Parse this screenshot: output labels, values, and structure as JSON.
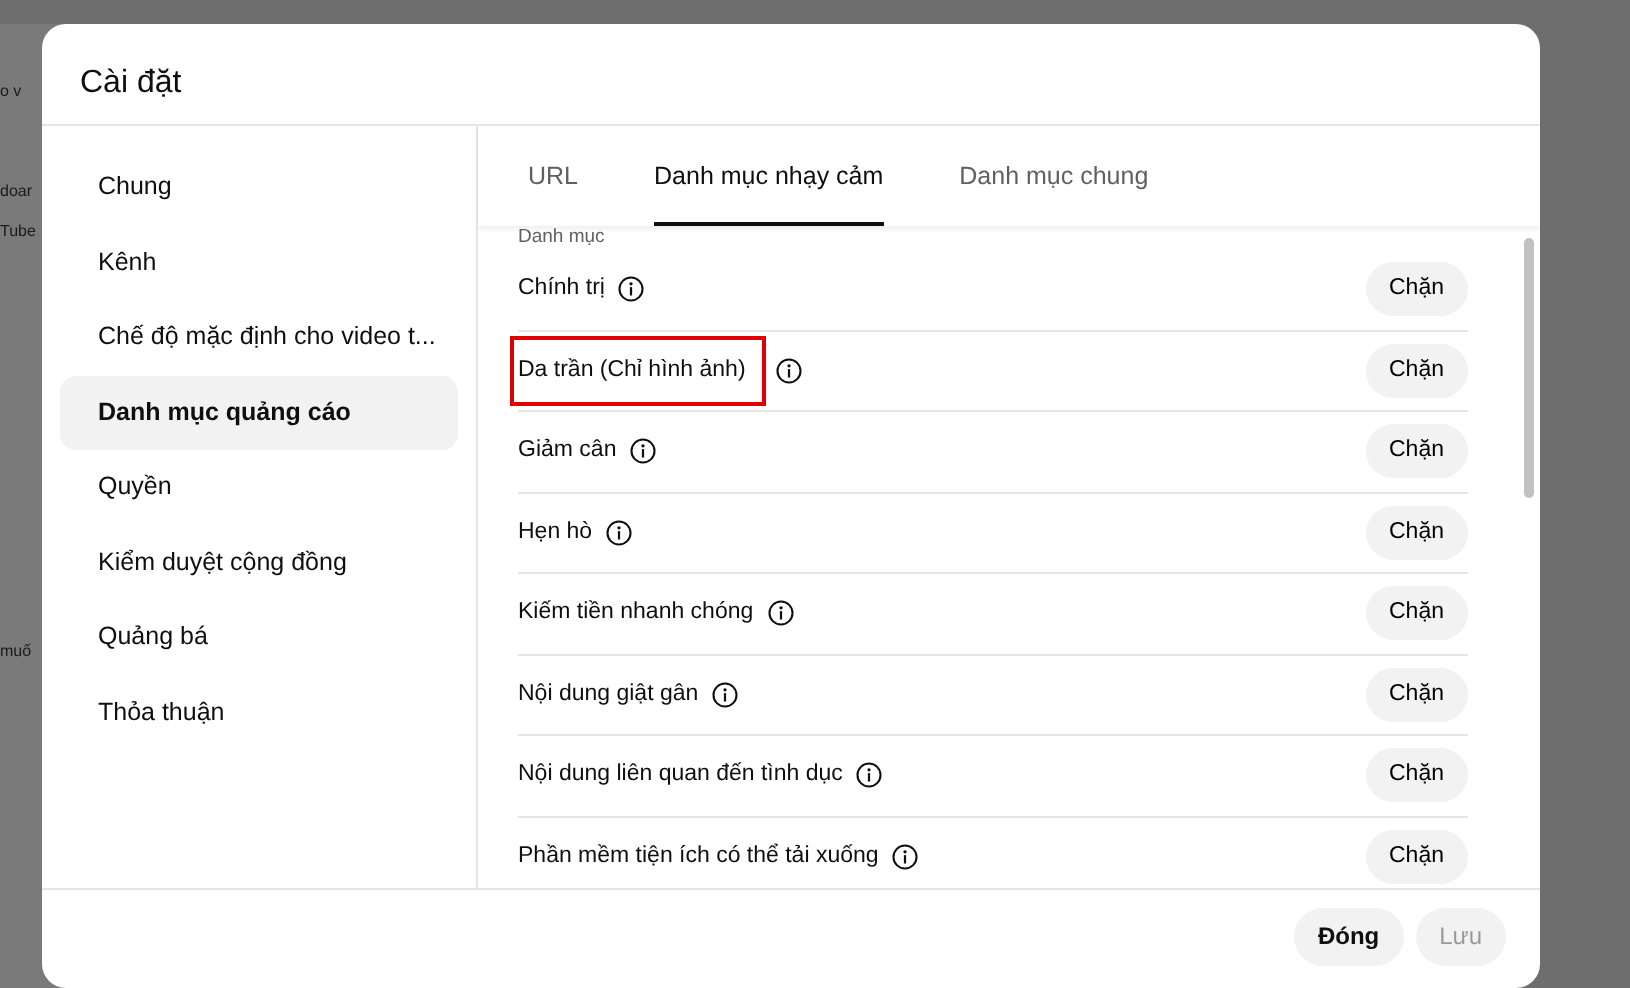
{
  "background_page": {
    "fragments": [
      "o v",
      "doar",
      "Tube",
      "muố"
    ]
  },
  "dialog": {
    "title": "Cài đặt",
    "sidebar": {
      "items": [
        {
          "label": "Chung",
          "selected": false
        },
        {
          "label": "Kênh",
          "selected": false
        },
        {
          "label": "Chế độ mặc định cho video t...",
          "selected": false
        },
        {
          "label": "Danh mục quảng cáo",
          "selected": true
        },
        {
          "label": "Quyền",
          "selected": false
        },
        {
          "label": "Kiểm duyệt cộng đồng",
          "selected": false
        },
        {
          "label": "Quảng bá",
          "selected": false
        },
        {
          "label": "Thỏa thuận",
          "selected": false
        }
      ]
    },
    "tabs": [
      {
        "label": "URL",
        "selected": false
      },
      {
        "label": "Danh mục nhạy cảm",
        "selected": true
      },
      {
        "label": "Danh mục chung",
        "selected": false
      }
    ],
    "section_label": "Danh mục",
    "categories": [
      {
        "label": "Chính trị",
        "highlighted": false,
        "button": "Chặn"
      },
      {
        "label": "Da trần (Chỉ hình ảnh)",
        "highlighted": true,
        "button": "Chặn"
      },
      {
        "label": "Giảm cân",
        "highlighted": false,
        "button": "Chặn"
      },
      {
        "label": "Hẹn hò",
        "highlighted": false,
        "button": "Chặn"
      },
      {
        "label": "Kiếm tiền nhanh chóng",
        "highlighted": false,
        "button": "Chặn"
      },
      {
        "label": "Nội dung giật gân",
        "highlighted": false,
        "button": "Chặn"
      },
      {
        "label": "Nội dung liên quan đến tình dục",
        "highlighted": false,
        "button": "Chặn"
      },
      {
        "label": "Phần mềm tiện ích có thể tải xuống",
        "highlighted": false,
        "button": "Chặn"
      }
    ],
    "footer_buttons": [
      {
        "label": "Đóng",
        "disabled": false
      },
      {
        "label": "Lưu",
        "disabled": true
      }
    ]
  }
}
